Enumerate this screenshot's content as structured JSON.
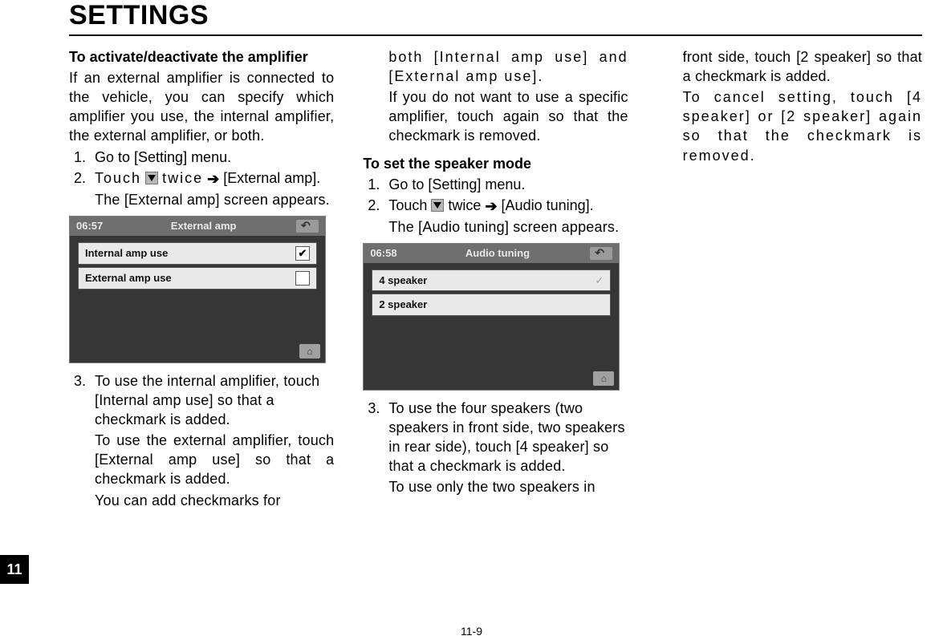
{
  "page": {
    "tab": "11",
    "number": "11-9",
    "title": "SETTINGS"
  },
  "col1": {
    "h1": "To activate/deactivate the amplifier",
    "p1": "If an external amplifier is connected to the vehicle, you can specify which amplifier you use, the internal amplifier, the external amplifier, or both.",
    "s1": "Go to [Setting] menu.",
    "s2a": "Touch",
    "s2b": "twice",
    "s2c": "[External amp].",
    "s2sub": "The [External amp] screen appears.",
    "screen": {
      "time": "06:57",
      "title": "External amp",
      "row1": "Internal amp use",
      "row2": "External amp use"
    },
    "s3": "To use the internal amplifier, touch [Internal amp use] so that a checkmark is added.",
    "s3b": "To use the external amplifier, touch [External amp use] so that a checkmark is added.",
    "s3c": "You can add checkmarks for"
  },
  "col2": {
    "contA": "both [Internal amp use] and [External amp use].",
    "contB": "If you do not want to use a specific amplifier, touch again so that the checkmark is removed.",
    "h2": "To set the speaker mode",
    "s1": "Go to [Setting] menu.",
    "s2a": "Touch",
    "s2b": "twice",
    "s2c": "[Audio tuning].",
    "s2sub": "The [Audio tuning] screen appears.",
    "screen": {
      "time": "06:58",
      "title": "Audio tuning",
      "row1": "4 speaker",
      "row2": "2 speaker"
    },
    "s3": "To use the four speakers (two speakers in front side, two speakers in rear side), touch [4 speaker] so that a checkmark is added.",
    "s3b": "To use only the two speakers in"
  },
  "col3": {
    "p1": "front side, touch [2 speaker] so that a checkmark is added.",
    "p2": "To cancel setting, touch [4 speaker] or [2 speaker] again so that the checkmark is removed."
  }
}
